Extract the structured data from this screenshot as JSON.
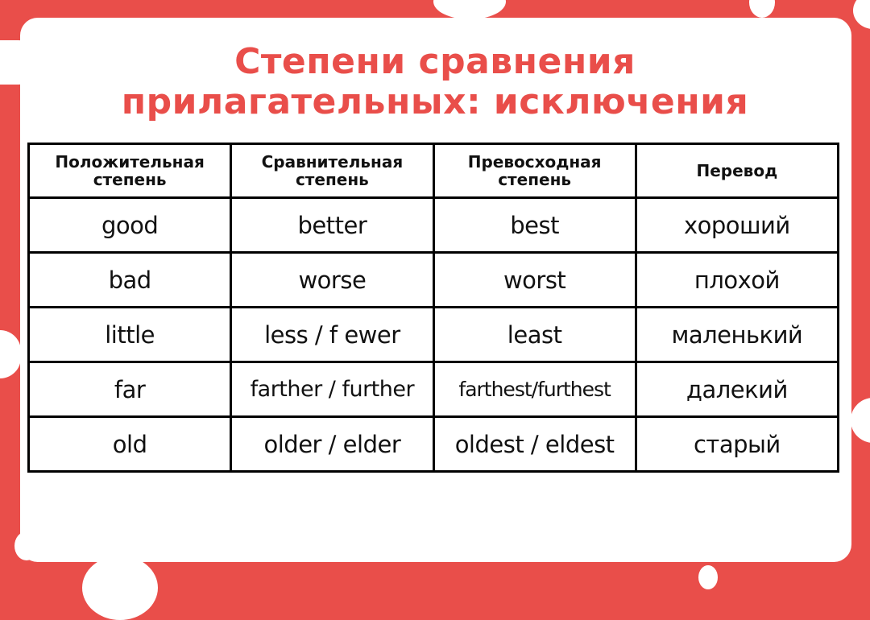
{
  "colors": {
    "accent": "#e94e4a",
    "background": "#ffffff",
    "text": "#111111"
  },
  "title": {
    "line1": "Степени сравнения",
    "line2": "прилагательных: исключения"
  },
  "table": {
    "headers": [
      {
        "line1": "Положительная",
        "line2": "степень"
      },
      {
        "line1": "Сравнительная",
        "line2": "степень"
      },
      {
        "line1": "Превосходная",
        "line2": "степень"
      },
      {
        "line1": "Перевод",
        "line2": ""
      }
    ],
    "rows": [
      [
        "good",
        "better",
        "best",
        "хороший"
      ],
      [
        "bad",
        "worse",
        "worst",
        "плохой"
      ],
      [
        "little",
        "less / f ewer",
        "least",
        "маленький"
      ],
      [
        "far",
        "farther / further",
        "farthest/furthest",
        "далекий"
      ],
      [
        "old",
        "older / elder",
        "oldest / eldest",
        "старый"
      ]
    ]
  }
}
